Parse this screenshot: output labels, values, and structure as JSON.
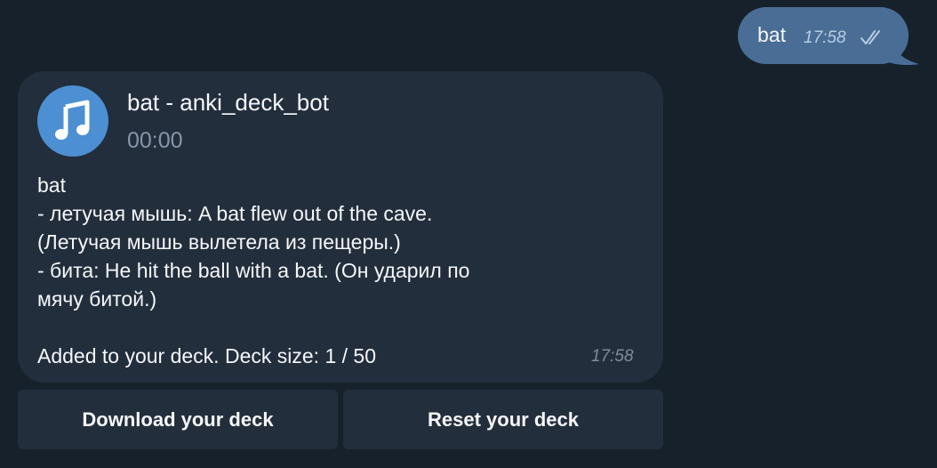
{
  "outgoing_message": {
    "text": "bat",
    "time": "17:58",
    "status_icon": "double-check-icon"
  },
  "incoming_message": {
    "audio": {
      "icon": "music-note-icon",
      "title": "bat - anki_deck_bot",
      "duration": "00:00"
    },
    "lines": [
      "bat",
      "- летучая мышь: A bat flew out of the cave.",
      "(Летучая мышь вылетела из пещеры.)",
      "- бита: He hit the ball with a bat. (Он ударил по",
      "мячу битой.)",
      "",
      "Added to your deck. Deck size: 1 / 50"
    ],
    "time": "17:58"
  },
  "inline_keyboard": {
    "download_label": "Download your deck",
    "reset_label": "Reset your deck"
  },
  "colors": {
    "background": "#17212b",
    "outgoing_bubble": "#4a6d96",
    "incoming_bubble": "#232e3c",
    "accent": "#4d8fd3"
  }
}
